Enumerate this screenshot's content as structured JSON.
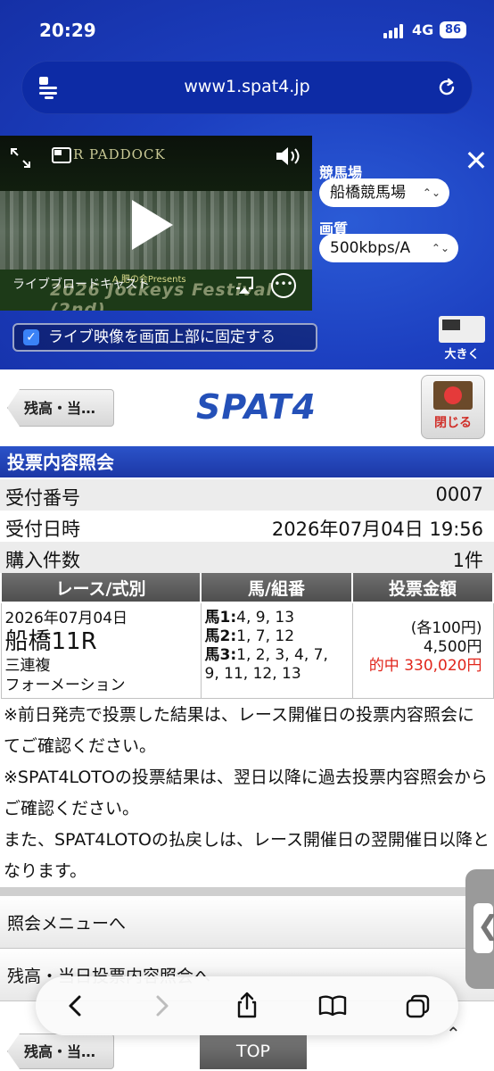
{
  "status_bar": {
    "time": "20:29",
    "network": "4G",
    "battery": "86"
  },
  "browser": {
    "url": "www1.spat4.jp"
  },
  "video": {
    "overlay_title": "R PADDOCK",
    "caption": "ライブブロードキャスト",
    "festival_text": "2026 Jockeys Festival (2nd)",
    "presents_text": "A.肥の会Presents",
    "venue_label": "競馬場",
    "venue_value": "船橋競馬場",
    "quality_label": "画質",
    "quality_value": "500kbps/A",
    "pin_label": "ライブ映像を画面上部に固定する",
    "enlarge_label": "大きく"
  },
  "header": {
    "back_label": "残高・当…",
    "logo": "SPAT4",
    "close_label": "閉じる"
  },
  "section_title": "投票内容照会",
  "info": {
    "receipt_no_label": "受付番号",
    "receipt_no": "0007",
    "receipt_time_label": "受付日時",
    "receipt_time": "2026年07月04日 19:56",
    "count_label": "購入件数",
    "count": "1件"
  },
  "table": {
    "headers": [
      "レース/式別",
      "馬/組番",
      "投票金額"
    ],
    "row": {
      "date": "2026年07月04日",
      "race": "船橋11R",
      "bet_type": "三連複",
      "formation": "フォーメーション",
      "horse1_label": "馬1:",
      "horse1": "4, 9, 13",
      "horse2_label": "馬2:",
      "horse2": "1, 7, 12",
      "horse3_label": "馬3:",
      "horse3": "1, 2, 3, 4, 7,",
      "horse3_cont": "9, 11, 12, 13",
      "unit": "(各100円)",
      "amount": "4,500円",
      "hit": "的中 330,020円"
    }
  },
  "notes": [
    "※前日発売で投票した結果は、レース開催日の投票内容照会にてご確認ください。",
    "※SPAT4LOTOの投票結果は、翌日以降に過去投票内容照会からご確認ください。",
    "また、SPAT4LOTOの払戻しは、レース開催日の翌開催日以降となります。"
  ],
  "menu": {
    "item1": "照会メニューへ",
    "item2": "残高・当日投票内容照会へ"
  },
  "footer": {
    "back_label": "残高・当…",
    "top_label": "TOP"
  }
}
